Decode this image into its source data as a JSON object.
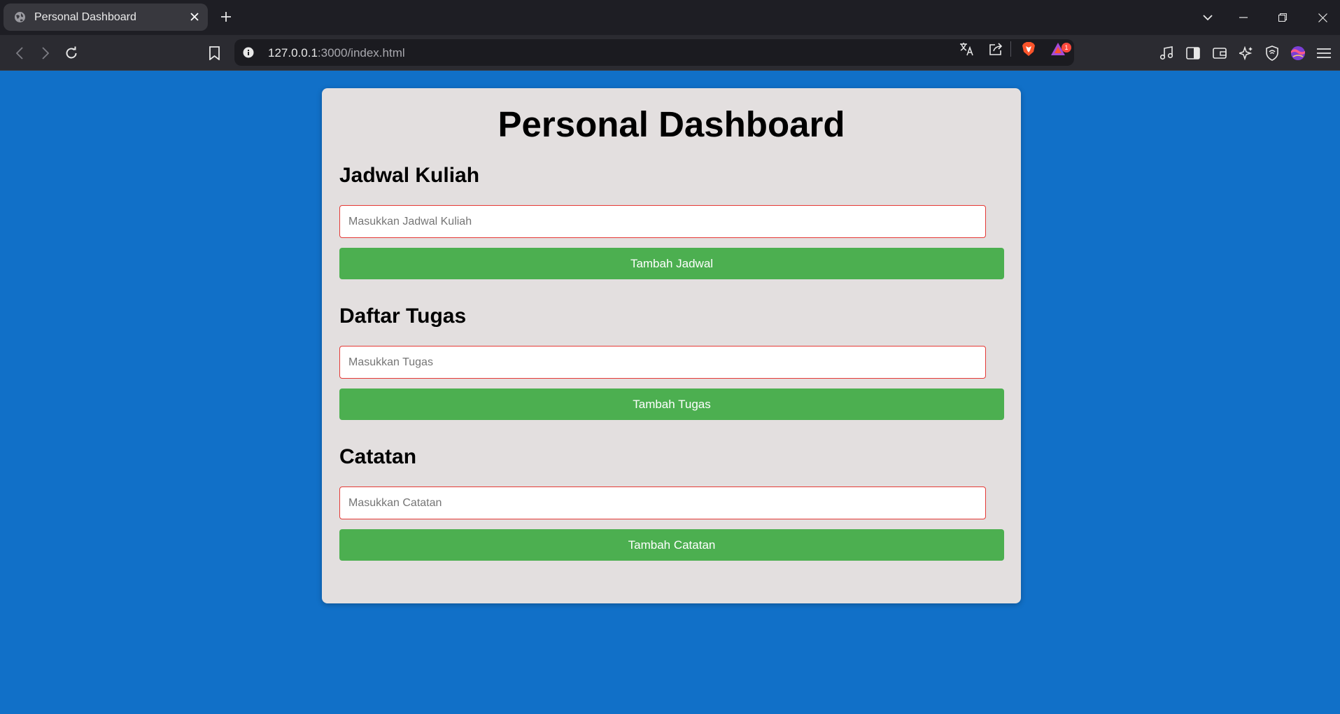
{
  "browser": {
    "tab_title": "Personal Dashboard",
    "url_host": "127.0.0.1",
    "url_rest": ":3000/index.html",
    "notification_count": "1",
    "icons": [
      "globe-icon",
      "close-icon",
      "plus-icon",
      "chevron-down-icon",
      "minimize-icon",
      "restore-icon",
      "window-close-icon",
      "back-icon",
      "forward-icon",
      "reload-icon",
      "bookmark-icon",
      "info-icon",
      "translate-icon",
      "share-icon",
      "brave-shield-icon",
      "brave-rewards-icon",
      "music-icon",
      "sidebar-icon",
      "wallet-icon",
      "leo-ai-icon",
      "vpn-icon",
      "profile-icon",
      "menu-icon"
    ]
  },
  "page": {
    "title": "Personal Dashboard",
    "sections": [
      {
        "title": "Jadwal Kuliah",
        "placeholder": "Masukkan Jadwal Kuliah",
        "button": "Tambah Jadwal"
      },
      {
        "title": "Daftar Tugas",
        "placeholder": "Masukkan Tugas",
        "button": "Tambah Tugas"
      },
      {
        "title": "Catatan",
        "placeholder": "Masukkan Catatan",
        "button": "Tambah Catatan"
      }
    ]
  },
  "colors": {
    "page_background": "#1170c8",
    "card_background": "#e3dfdf",
    "button": "#4caf50",
    "input_border": "#e53935"
  }
}
